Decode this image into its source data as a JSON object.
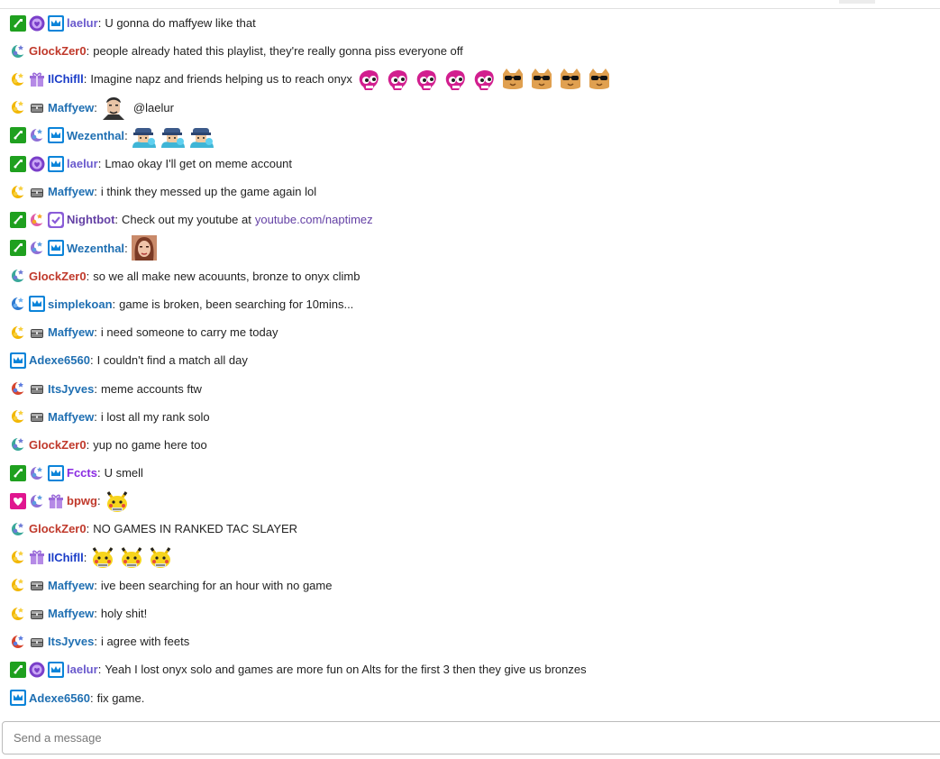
{
  "chat": {
    "messages": [
      {
        "badges": [
          "verified",
          "heart-purple",
          "prime"
        ],
        "user": "laelur",
        "color": "#6a5acd",
        "text": "U gonna do maffyew like that",
        "emotes": []
      },
      {
        "badges": [
          "moon-green"
        ],
        "user": "GlockZer0",
        "color": "#c0392b",
        "text": "people already hated this playlist, they're really gonna piss everyone off",
        "emotes": []
      },
      {
        "badges": [
          "moon-yellow",
          "gift"
        ],
        "user": "IlChifll",
        "color": "#1a3cc8",
        "text": "Imagine napz and friends helping us to reach onyx",
        "emotes": [
          "pink-skull",
          "pink-skull",
          "pink-skull",
          "pink-skull",
          "pink-skull",
          "cool-cat",
          "cool-cat",
          "cool-cat",
          "cool-cat"
        ]
      },
      {
        "badges": [
          "moon-yellow",
          "chest"
        ],
        "user": "Maffyew",
        "color": "#1f6fb2",
        "text": "",
        "emotes": [
          "face-man"
        ],
        "mention": "@laelur"
      },
      {
        "badges": [
          "verified",
          "moon-purple",
          "prime"
        ],
        "user": "Wezenthal",
        "color": "#1f6fb2",
        "text": "",
        "emotes": [
          "guy-cap",
          "guy-cap",
          "guy-cap"
        ]
      },
      {
        "badges": [
          "verified",
          "heart-purple",
          "prime"
        ],
        "user": "laelur",
        "color": "#6a5acd",
        "text": "Lmao okay I'll get on meme account",
        "emotes": []
      },
      {
        "badges": [
          "moon-yellow",
          "chest"
        ],
        "user": "Maffyew",
        "color": "#1f6fb2",
        "text": "i think they messed up the game again lol",
        "emotes": []
      },
      {
        "badges": [
          "verified",
          "moon-pink",
          "bot"
        ],
        "user": "Nightbot",
        "color": "#6441a5",
        "text": "Check out my youtube at",
        "emotes": [],
        "link": "youtube.com/naptimez"
      },
      {
        "badges": [
          "verified",
          "moon-purple",
          "prime"
        ],
        "user": "Wezenthal",
        "color": "#1f6fb2",
        "text": "",
        "emotes": [
          "face-woman"
        ]
      },
      {
        "badges": [
          "moon-green"
        ],
        "user": "GlockZer0",
        "color": "#c0392b",
        "text": "so we all make new acouunts, bronze to onyx climb",
        "emotes": []
      },
      {
        "badges": [
          "moon-blue",
          "prime"
        ],
        "user": "simplekoan",
        "color": "#1f6fb2",
        "text": "game is broken, been searching for 10mins...",
        "emotes": []
      },
      {
        "badges": [
          "moon-yellow",
          "chest"
        ],
        "user": "Maffyew",
        "color": "#1f6fb2",
        "text": "i need someone to carry me today",
        "emotes": []
      },
      {
        "badges": [
          "prime"
        ],
        "user": "Adexe6560",
        "color": "#1f6fb2",
        "text": "I couldn't find a match all day",
        "emotes": []
      },
      {
        "badges": [
          "moon-red",
          "chest"
        ],
        "user": "ItsJyves",
        "color": "#1f6fb2",
        "text": "meme accounts ftw",
        "emotes": []
      },
      {
        "badges": [
          "moon-yellow",
          "chest"
        ],
        "user": "Maffyew",
        "color": "#1f6fb2",
        "text": "i lost all my rank solo",
        "emotes": []
      },
      {
        "badges": [
          "moon-green"
        ],
        "user": "GlockZer0",
        "color": "#c0392b",
        "text": "yup no game here too",
        "emotes": []
      },
      {
        "badges": [
          "verified",
          "moon-purple",
          "prime"
        ],
        "user": "Fccts",
        "color": "#8a2be2",
        "text": "U smell",
        "emotes": []
      },
      {
        "badges": [
          "heart-pink",
          "moon-purple",
          "gift"
        ],
        "user": "bpwg",
        "color": "#c0392b",
        "text": "",
        "emotes": [
          "pikachu"
        ]
      },
      {
        "badges": [
          "moon-green"
        ],
        "user": "GlockZer0",
        "color": "#c0392b",
        "text": "NO GAMES IN RANKED TAC SLAYER",
        "emotes": []
      },
      {
        "badges": [
          "moon-yellow",
          "gift"
        ],
        "user": "IlChifll",
        "color": "#1a3cc8",
        "text": "",
        "emotes": [
          "pikachu",
          "pikachu",
          "pikachu"
        ]
      },
      {
        "badges": [
          "moon-yellow",
          "chest"
        ],
        "user": "Maffyew",
        "color": "#1f6fb2",
        "text": "ive been searching for an hour with no game",
        "emotes": []
      },
      {
        "badges": [
          "moon-yellow",
          "chest"
        ],
        "user": "Maffyew",
        "color": "#1f6fb2",
        "text": "holy shit!",
        "emotes": []
      },
      {
        "badges": [
          "moon-red",
          "chest"
        ],
        "user": "ItsJyves",
        "color": "#1f6fb2",
        "text": "i agree with feets",
        "emotes": []
      },
      {
        "badges": [
          "verified",
          "heart-purple",
          "prime"
        ],
        "user": "laelur",
        "color": "#6a5acd",
        "text": "Yeah I lost onyx solo and games are more fun on Alts for the first 3 then they give us bronzes",
        "emotes": []
      },
      {
        "badges": [
          "prime"
        ],
        "user": "Adexe6560",
        "color": "#1f6fb2",
        "text": "fix game.",
        "emotes": []
      }
    ]
  },
  "input": {
    "placeholder": "Send a message",
    "value": ""
  }
}
